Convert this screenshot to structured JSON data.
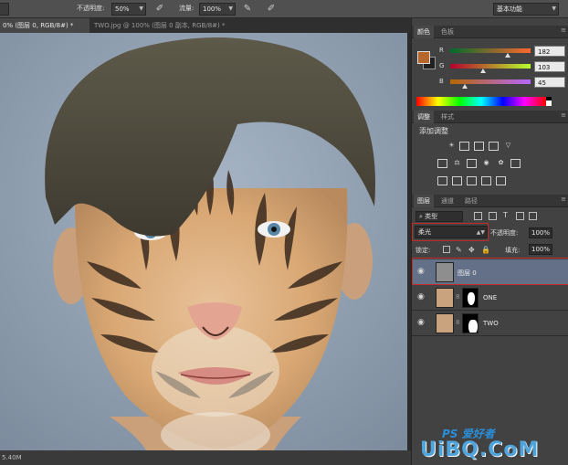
{
  "options_bar": {
    "opacity_label": "不透明度:",
    "opacity_value": "50%",
    "flow_label": "流量:",
    "flow_value": "100%",
    "workspace": "基本功能"
  },
  "tabs": [
    {
      "label": "0% (图层 0, RGB/8#) *",
      "active": true
    },
    {
      "label": "TWO.jpg @ 100% (图层 0 副本, RGB/8#) *",
      "active": false
    }
  ],
  "status_bar": {
    "text": "5.40M"
  },
  "color_panel": {
    "tabs": [
      "颜色",
      "色板"
    ],
    "fg_color": "#b6672d",
    "channels": [
      {
        "label": "R",
        "value": "182",
        "fraction": 0.714
      },
      {
        "label": "G",
        "value": "103",
        "fraction": 0.404
      },
      {
        "label": "B",
        "value": "45",
        "fraction": 0.176
      }
    ]
  },
  "adjustments_panel": {
    "tabs": [
      "调整",
      "样式"
    ],
    "title": "添加调整"
  },
  "layers_panel": {
    "tabs": [
      "图层",
      "通道",
      "路径"
    ],
    "filter_label": "类型",
    "blend_mode": "柔光",
    "opacity_label": "不透明度:",
    "opacity_value": "100%",
    "lock_label": "锁定:",
    "fill_label": "填充:",
    "fill_value": "100%",
    "layers": [
      {
        "name": "图层 0",
        "selected": true
      },
      {
        "name": "ONE",
        "selected": false
      },
      {
        "name": "TWO",
        "selected": false
      }
    ]
  },
  "watermark": {
    "line1": "PS 爱好者",
    "line2": "UiBQ.CoM"
  }
}
